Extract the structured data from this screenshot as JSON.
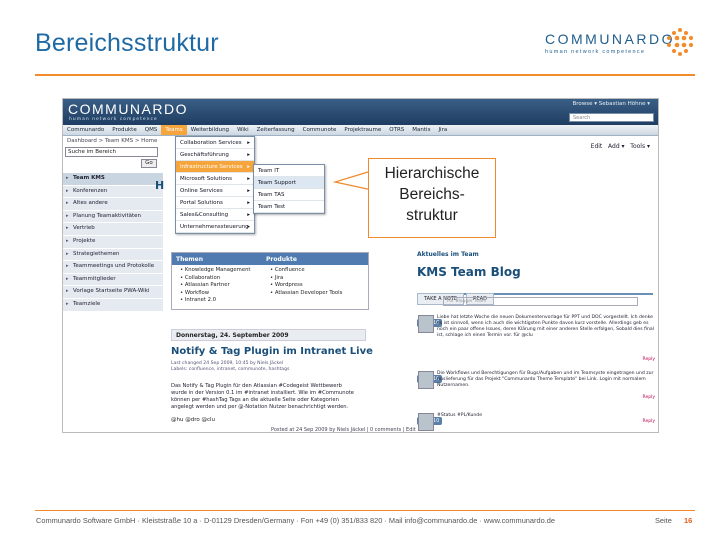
{
  "slide": {
    "title": "Bereichsstruktur",
    "brand_name": "COMMUNARDO",
    "brand_tagline": "human network competence",
    "footer": "Communardo Software GmbH · Kleiststraße 10 a · D-01129 Dresden/Germany  · Fon +49 (0) 351/833 820 · Mail info@communardo.de · www.communardo.de",
    "page_label": "Seite",
    "page_number": "16",
    "callout": [
      "Hierarchische",
      "Bereichs-",
      "struktur"
    ],
    "colors": {
      "accent": "#f28b2a",
      "title": "#1f6aa5",
      "nav": "#1f3d62"
    }
  },
  "screenshot": {
    "logo": "COMMUNARDO",
    "logo_tagline": "human network competence",
    "header_links": "Browse ▾  Sebastian Höhne ▾",
    "search_placeholder": "Search",
    "nav": [
      "Communardo",
      "Produkte",
      "QMS",
      "Teams",
      "Weiterbildung",
      "Wiki",
      "Zeiterfassung",
      "Communote",
      "Projektraume",
      "OTRS",
      "Mantis",
      "Jira"
    ],
    "active_nav": "Teams",
    "breadcrumb": "Dashboard > Team KMS > Home",
    "search_label": "Suche im Bereich",
    "go_label": "Go",
    "left_nav": [
      "Team KMS",
      "Konferenzen",
      "Altes andere",
      "Planung Teamaktivitäten",
      "Vertrieb",
      "Projekte",
      "Strategiethemen",
      "Teammeetings und Protokolle",
      "Teammitglieder",
      "Vorlage Startseite PWA-Wiki",
      "Teamziele"
    ],
    "menu1": [
      "Collaboration Services",
      "Geschäftsführung",
      "Infrastructure Services",
      "Microsoft Solutions",
      "Online Services",
      "Portal Solutions",
      "Sales&Consulting",
      "Unternehmenssteuerung"
    ],
    "menu1_highlight": "Infrastructure Services",
    "menu2": [
      "Team IT",
      "Team Support",
      "Team TAS",
      "Team Test"
    ],
    "menu2_selected": "Team Support",
    "page_heading": "H",
    "tools": [
      "Edit",
      "Add ▾",
      "Tools ▾"
    ],
    "table_headers": [
      "Themen",
      "Produkte"
    ],
    "themen": [
      "Knowledge Management",
      "Collaboration",
      "Atlassian Partner",
      "Workflow",
      "Intranet 2.0"
    ],
    "produkte": [
      "Confluence",
      "Jira",
      "Wordpress",
      "Atlassian Developer Tools"
    ],
    "post_date": "Donnerstag, 24. September 2009",
    "post_title": "Notify & Tag Plugin im Intranet Live",
    "post_meta": "Last changed 24 Sep 2009, 10:45 by Niels Jäckel\nLabels: confluence, intranet, communote, hashtags",
    "post_body": "Das Notify & Tag Plugin für den Atlassian #Codegeist Wettbewerb wurde in der Version 0.1 im #intranet installiert. Wie im #Communote können per #hashTag Tags an die aktuelle Seite oder Kategorien angelegt werden und per @-Notation Nutzer benachrichtigt werden.",
    "post_sig": "@hu @dro @clu",
    "post_footer": "Posted at 24 Sep 2009 by Niels Jäckel | 0 comments | Edit",
    "aktuelles": "Aktuelles im Team",
    "blog_title": "KMS Team Blog",
    "blog_tabs": [
      "TAKE A NOTE",
      "READ"
    ],
    "blog_input": "For Blogger Team",
    "blog_entries": [
      {
        "date": "30/4/10",
        "text": "Liebe hat letzte Woche die neuen Dokumentenvorlage für PPT und DOC vorgestellt. Ich denke es ist sinnvoll, wenn ich auch die wichtigsten Punkte davon kurz vorstelle. Allerdings geb es noch ein paar offene Issues, deren Klärung mit einer anderen Stelle erfolgen, Sobald dies final ist, schlage ich einen Termin vor. für @clu",
        "more": "Reply"
      },
      {
        "date": "30/4/10",
        "text": "Die Workflows und Berechtigungen für Bugs/Aufgaben und im Teamsyste eingetragen und zur Auslieferung für das Projekt \"Communardo Theme Template\" bei Link. Login mit normalem Nutzernamen.",
        "more": "Reply"
      },
      {
        "date": "29/4/10",
        "text": "#Status #PL/Kunde",
        "more": "Reply"
      }
    ]
  }
}
